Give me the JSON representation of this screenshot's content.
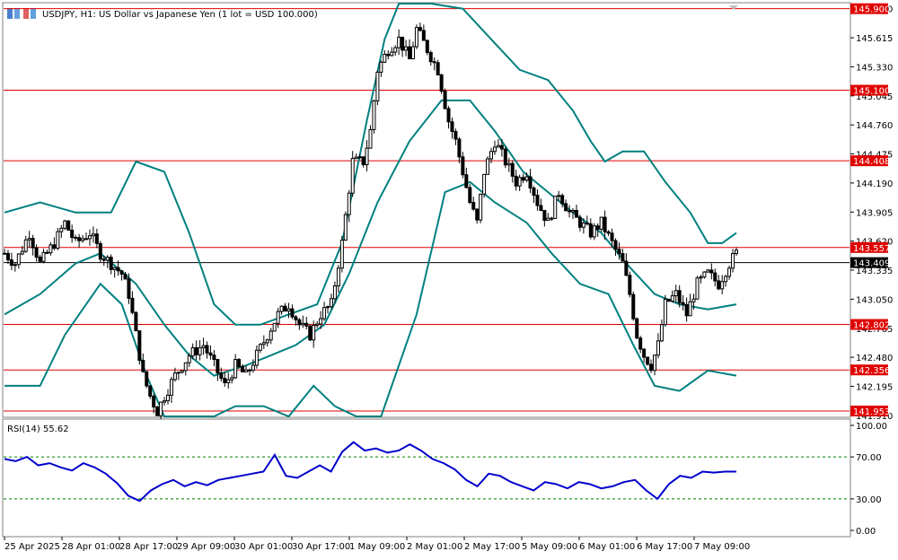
{
  "header": {
    "title": "USDJPY, H1:  US Dollar vs Japanese Yen (1 lot = USD 100.000)"
  },
  "colors": {
    "candle": "#000000",
    "band": "#008080",
    "level": "#e00000",
    "rsi": "#0000cc",
    "rsi_level": "#008000",
    "current": "#000000"
  },
  "chart_data": [
    {
      "type": "candlestick",
      "title": "",
      "ylim": [
        141.9,
        145.95
      ],
      "y_ticks": [
        "145.900",
        "145.615",
        "145.330",
        "145.045",
        "144.760",
        "144.475",
        "144.190",
        "143.905",
        "143.620",
        "143.335",
        "143.050",
        "142.765",
        "142.480",
        "142.195",
        "141.910"
      ],
      "x_labels": [
        "25 Apr 2025",
        "28 Apr 01:00",
        "28 Apr 17:00",
        "29 Apr 09:00",
        "30 Apr 01:00",
        "30 Apr 17:00",
        "1 May 09:00",
        "2 May 01:00",
        "2 May 17:00",
        "5 May 09:00",
        "6 May 01:00",
        "6 May 17:00",
        "7 May 09:00"
      ],
      "horizontal_levels": [
        "145.900",
        "145.100",
        "144.408",
        "143.557",
        "142.802",
        "142.356",
        "141.953"
      ],
      "current_price": "143.409",
      "close_path": [
        [
          0,
          143.5
        ],
        [
          6,
          143.4
        ],
        [
          14,
          143.7
        ],
        [
          20,
          143.4
        ],
        [
          28,
          143.6
        ],
        [
          34,
          143.8
        ],
        [
          40,
          143.6
        ],
        [
          48,
          143.7
        ],
        [
          54,
          143.5
        ],
        [
          60,
          143.4
        ],
        [
          66,
          143.3
        ],
        [
          70,
          143.1
        ],
        [
          74,
          142.7
        ],
        [
          78,
          142.3
        ],
        [
          82,
          142.1
        ],
        [
          86,
          141.95
        ],
        [
          90,
          142.1
        ],
        [
          96,
          142.3
        ],
        [
          104,
          142.5
        ],
        [
          112,
          142.6
        ],
        [
          118,
          142.4
        ],
        [
          124,
          142.2
        ],
        [
          130,
          142.4
        ],
        [
          136,
          142.3
        ],
        [
          142,
          142.5
        ],
        [
          148,
          142.7
        ],
        [
          154,
          142.9
        ],
        [
          160,
          143.0
        ],
        [
          166,
          142.8
        ],
        [
          172,
          142.7
        ],
        [
          178,
          142.9
        ],
        [
          184,
          143.0
        ],
        [
          190,
          143.6
        ],
        [
          196,
          144.4
        ],
        [
          202,
          144.4
        ],
        [
          206,
          144.7
        ],
        [
          210,
          145.3
        ],
        [
          216,
          145.5
        ],
        [
          222,
          145.6
        ],
        [
          228,
          145.4
        ],
        [
          232,
          145.7
        ],
        [
          238,
          145.5
        ],
        [
          244,
          145.3
        ],
        [
          250,
          144.8
        ],
        [
          254,
          144.6
        ],
        [
          258,
          144.3
        ],
        [
          262,
          144.0
        ],
        [
          266,
          143.8
        ],
        [
          270,
          144.3
        ],
        [
          276,
          144.6
        ],
        [
          282,
          144.4
        ],
        [
          288,
          144.2
        ],
        [
          294,
          144.3
        ],
        [
          300,
          144.0
        ],
        [
          306,
          143.8
        ],
        [
          312,
          144.1
        ],
        [
          318,
          143.9
        ],
        [
          324,
          143.8
        ],
        [
          330,
          143.7
        ],
        [
          336,
          143.8
        ],
        [
          342,
          143.6
        ],
        [
          348,
          143.4
        ],
        [
          352,
          143.1
        ],
        [
          356,
          142.7
        ],
        [
          360,
          142.5
        ],
        [
          364,
          142.4
        ],
        [
          368,
          142.6
        ],
        [
          372,
          143.0
        ],
        [
          378,
          143.1
        ],
        [
          384,
          142.9
        ],
        [
          390,
          143.2
        ],
        [
          396,
          143.3
        ],
        [
          402,
          143.2
        ],
        [
          408,
          143.4
        ],
        [
          412,
          143.5
        ]
      ],
      "bollinger_upper": [
        [
          0,
          143.9
        ],
        [
          20,
          144.0
        ],
        [
          40,
          143.9
        ],
        [
          60,
          143.9
        ],
        [
          74,
          144.4
        ],
        [
          90,
          144.3
        ],
        [
          104,
          143.7
        ],
        [
          118,
          143.0
        ],
        [
          130,
          142.8
        ],
        [
          144,
          142.8
        ],
        [
          160,
          142.9
        ],
        [
          176,
          143.0
        ],
        [
          190,
          143.6
        ],
        [
          204,
          144.8
        ],
        [
          214,
          145.6
        ],
        [
          222,
          146.0
        ],
        [
          240,
          146.2
        ],
        [
          258,
          145.9
        ],
        [
          274,
          145.6
        ],
        [
          290,
          145.3
        ],
        [
          306,
          145.2
        ],
        [
          320,
          144.9
        ],
        [
          330,
          144.6
        ],
        [
          338,
          144.4
        ],
        [
          348,
          144.5
        ],
        [
          360,
          144.5
        ],
        [
          372,
          144.2
        ],
        [
          386,
          143.9
        ],
        [
          396,
          143.6
        ],
        [
          404,
          143.6
        ],
        [
          412,
          143.7
        ]
      ],
      "bollinger_middle": [
        [
          0,
          142.9
        ],
        [
          20,
          143.1
        ],
        [
          40,
          143.4
        ],
        [
          54,
          143.5
        ],
        [
          74,
          143.2
        ],
        [
          90,
          142.8
        ],
        [
          104,
          142.5
        ],
        [
          118,
          142.3
        ],
        [
          136,
          142.4
        ],
        [
          150,
          142.5
        ],
        [
          164,
          142.6
        ],
        [
          180,
          142.8
        ],
        [
          194,
          143.3
        ],
        [
          210,
          144.0
        ],
        [
          228,
          144.6
        ],
        [
          246,
          145.0
        ],
        [
          262,
          145.0
        ],
        [
          276,
          144.7
        ],
        [
          292,
          144.3
        ],
        [
          306,
          144.1
        ],
        [
          320,
          143.9
        ],
        [
          336,
          143.7
        ],
        [
          350,
          143.4
        ],
        [
          366,
          143.1
        ],
        [
          380,
          143.0
        ],
        [
          396,
          142.95
        ],
        [
          412,
          143.0
        ]
      ],
      "bollinger_lower": [
        [
          0,
          142.2
        ],
        [
          20,
          142.2
        ],
        [
          34,
          142.7
        ],
        [
          54,
          143.2
        ],
        [
          66,
          143.0
        ],
        [
          80,
          142.3
        ],
        [
          90,
          141.8
        ],
        [
          104,
          141.7
        ],
        [
          118,
          141.8
        ],
        [
          130,
          142.0
        ],
        [
          146,
          142.0
        ],
        [
          160,
          141.9
        ],
        [
          174,
          142.2
        ],
        [
          186,
          142.0
        ],
        [
          198,
          141.8
        ],
        [
          212,
          141.9
        ],
        [
          232,
          142.9
        ],
        [
          248,
          144.1
        ],
        [
          262,
          144.2
        ],
        [
          276,
          144.0
        ],
        [
          294,
          143.8
        ],
        [
          308,
          143.5
        ],
        [
          324,
          143.2
        ],
        [
          340,
          143.1
        ],
        [
          354,
          142.6
        ],
        [
          366,
          142.2
        ],
        [
          380,
          142.15
        ],
        [
          396,
          142.35
        ],
        [
          412,
          142.3
        ]
      ]
    },
    {
      "type": "line",
      "title": "RSI(14) 55.62",
      "ylim": [
        0,
        100
      ],
      "y_ticks": [
        "100.00",
        "70.00",
        "30.00",
        "0.00"
      ],
      "levels": [
        70,
        30
      ],
      "x": [
        0,
        8,
        16,
        24,
        32,
        40,
        48,
        56,
        64,
        72,
        80,
        88,
        96,
        104,
        112,
        120,
        128,
        136,
        144,
        152,
        160,
        168,
        176,
        184,
        190,
        198,
        206,
        214,
        222,
        230,
        238,
        246,
        254,
        262,
        270,
        278,
        286,
        294,
        302,
        310,
        318,
        326,
        334,
        342,
        350,
        358,
        366,
        372,
        380,
        388,
        396,
        404,
        412
      ],
      "values": [
        68,
        66,
        70,
        62,
        64,
        60,
        57,
        64,
        60,
        54,
        45,
        33,
        28,
        38,
        44,
        48,
        42,
        46,
        43,
        48,
        50,
        52,
        54,
        56,
        72,
        52,
        50,
        56,
        62,
        56,
        75,
        84,
        76,
        78,
        74,
        76,
        82,
        76,
        68,
        64,
        58,
        48,
        42,
        54,
        52,
        46,
        42,
        38,
        46,
        44,
        40,
        46,
        44,
        40,
        42,
        46,
        48,
        38,
        30,
        44,
        52,
        50,
        56,
        55,
        56,
        56
      ]
    }
  ]
}
